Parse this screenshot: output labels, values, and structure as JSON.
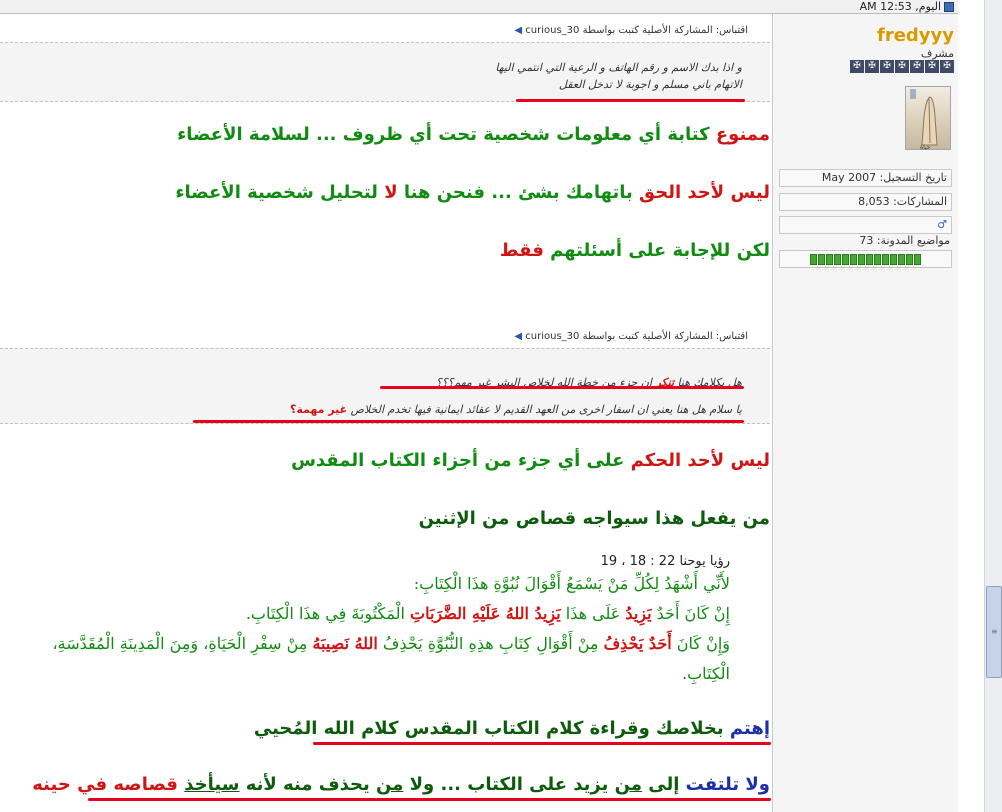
{
  "header": {
    "time": "اليوم, 12:53 AM"
  },
  "quotes": [
    {
      "header": "اقتباس: المشاركة الأصلية كتبت بواسطة curious_30",
      "lines": [
        "و اذا بدك الاسم و رقم الهاتف و الرعية التي انتمي اليها",
        "الاتهام باني مسلم و اجوبة لا تدخل العقل"
      ]
    },
    {
      "header": "اقتباس: المشاركة الأصلية كتبت بواسطة curious_30",
      "line1": {
        "pre": "هل بكلامك هنا ",
        "red": "تنكر",
        "post": " ان جزء من خطة الله لخلاص البشر غير مهم؟؟؟"
      },
      "line2": {
        "pre": "يا سلام هل هنا يعني ان اسفار اخرى من العهد القديم لا عقائد ايمانية فيها تخدم الخلاص ",
        "red": "غير مهمة؟"
      }
    }
  ],
  "paragraphs": {
    "p1": {
      "a": "ممنوع",
      "b": " كتابة أي معلومات شخصية تحت أي ظروف ... لسلامة الأعضاء"
    },
    "p2": {
      "a": "ليس لأحد الحق",
      "b": " باتهامك بشئ ... فنحن هنا ",
      "c": "لا",
      "d": " لتحليل شخصية الأعضاء"
    },
    "p3": {
      "a": "لكن للإجابة على أسئلتهم ",
      "b": "فقط"
    },
    "p4": {
      "a": "ليس لأحد الحكم",
      "b": " على أي جزء من أجزاء الكتاب المقدس"
    },
    "p5": {
      "a": "من يفعل هذا سيواجه قصاص من الإثنين"
    },
    "p6": {
      "a": "إهتم",
      "b": " بخلاصك وقراءة كلام الكتاب المقدس كلام الله المُحيي"
    },
    "p7": {
      "a": "ولا تلتفت",
      "b": " إلى ",
      "c": "من",
      "d": " يزيد على الكتاب ... ولا ",
      "e": "من",
      "f": " يحذف منه لأنه ",
      "g": "سيأخذ",
      "h": " قصاصه في حينه"
    }
  },
  "verse": {
    "ref": "رؤيا يوحنا 22 : 18 ، 19",
    "l1": "لأَنِّي أَشْهَدُ لِكُلِّ مَنْ يَسْمَعُ أَقْوَالَ نُبُوَّةِ هذَا الْكِتَابِ:",
    "l2pre": "إِنْ كَانَ أَحَدٌ ",
    "l2r1": "يَزِيدُ",
    "l2mid": " عَلَى هذَا ",
    "l2r2": "يَزِيدُ اللهُ عَلَيْهِ الضَّرَبَاتِ",
    "l2post": " الْمَكْتُوبَةَ فِي هذَا الْكِتَابِ.",
    "l3pre": "وَإِنْ كَانَ ",
    "l3r1": "أَحَدٌ يَحْذِفُ",
    "l3mid": " مِنْ أَقْوَالِ كِتَابِ هذِهِ النُّبُوَّةِ يَحْذِفُ ",
    "l3r2": "اللهُ نَصِيبَهُ",
    "l3post": " مِنْ سِفْرِ الْحَيَاةِ، وَمِنَ الْمَدِينَةِ الْمُقَدَّسَةِ،",
    "l4": "الْكِتَابِ."
  },
  "user": {
    "name": "fredyyy",
    "role": "مشرف",
    "stars": [
      "✠",
      "✠",
      "✠",
      "✠",
      "✠",
      "✠",
      "✠"
    ],
    "avatar_label": "حياة",
    "join": "تاريخ التسجيل: May 2007",
    "posts": "المشاركات: 8,053",
    "gender": "♂",
    "blog": "مواضيع المدونة: 73",
    "rep_count": 14
  },
  "colors": {
    "green": "#118b11",
    "red": "#d01515",
    "blue": "#1d2fa6",
    "username": "#d99a00"
  }
}
